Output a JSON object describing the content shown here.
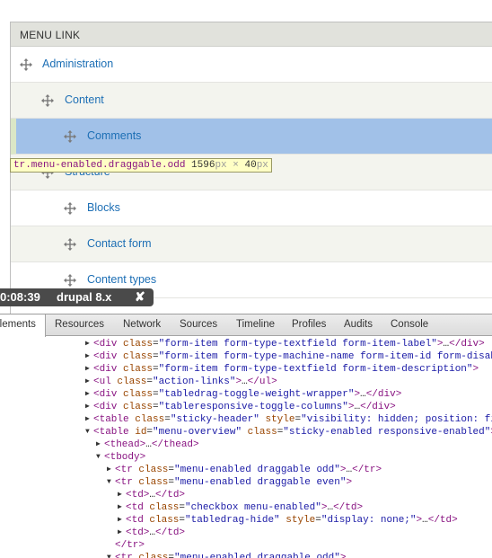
{
  "table": {
    "header": "MENU LINK",
    "rows": [
      {
        "label": "Administration"
      },
      {
        "label": "Content"
      },
      {
        "label": "Comments"
      },
      {
        "label": "Structure"
      },
      {
        "label": "Blocks"
      },
      {
        "label": "Contact form"
      },
      {
        "label": "Content types"
      }
    ]
  },
  "tooltip": {
    "selector": "tr.menu-enabled.draggable.odd",
    "width": "1596",
    "unit": "px",
    "times": "×",
    "height": "40"
  },
  "recording": {
    "time": "0:08:39",
    "site": "drupal 8.x",
    "close": "✘"
  },
  "devtools": {
    "tabs": [
      "Elements",
      "Resources",
      "Network",
      "Sources",
      "Timeline",
      "Profiles",
      "Audits",
      "Console"
    ],
    "active_tab": "Elements",
    "lines": [
      {
        "indent": 0,
        "tri": "▶",
        "parts": [
          [
            "tg",
            "<div "
          ],
          [
            "an",
            "class"
          ],
          [
            "pl",
            "="
          ],
          [
            "av",
            "\"form-item form-type-textfield form-item-label\""
          ],
          [
            "tg",
            ">"
          ],
          [
            "pl",
            "…"
          ],
          [
            "tg",
            "</div>"
          ]
        ]
      },
      {
        "indent": 0,
        "tri": "▶",
        "parts": [
          [
            "tg",
            "<div "
          ],
          [
            "an",
            "class"
          ],
          [
            "pl",
            "="
          ],
          [
            "av",
            "\"form-item form-type-machine-name form-item-id form-disabled\""
          ],
          [
            "tg",
            ">"
          ]
        ]
      },
      {
        "indent": 0,
        "tri": "▶",
        "parts": [
          [
            "tg",
            "<div "
          ],
          [
            "an",
            "class"
          ],
          [
            "pl",
            "="
          ],
          [
            "av",
            "\"form-item form-type-textfield form-item-description\""
          ],
          [
            "tg",
            ">"
          ]
        ]
      },
      {
        "indent": 0,
        "tri": "▶",
        "parts": [
          [
            "tg",
            "<ul "
          ],
          [
            "an",
            "class"
          ],
          [
            "pl",
            "="
          ],
          [
            "av",
            "\"action-links\""
          ],
          [
            "tg",
            ">"
          ],
          [
            "pl",
            "…"
          ],
          [
            "tg",
            "</ul>"
          ]
        ]
      },
      {
        "indent": 0,
        "tri": "▶",
        "parts": [
          [
            "tg",
            "<div "
          ],
          [
            "an",
            "class"
          ],
          [
            "pl",
            "="
          ],
          [
            "av",
            "\"tabledrag-toggle-weight-wrapper\""
          ],
          [
            "tg",
            ">"
          ],
          [
            "pl",
            "…"
          ],
          [
            "tg",
            "</div>"
          ]
        ]
      },
      {
        "indent": 0,
        "tri": "▶",
        "parts": [
          [
            "tg",
            "<div "
          ],
          [
            "an",
            "class"
          ],
          [
            "pl",
            "="
          ],
          [
            "av",
            "\"tableresponsive-toggle-columns\""
          ],
          [
            "tg",
            ">"
          ],
          [
            "pl",
            "…"
          ],
          [
            "tg",
            "</div>"
          ]
        ]
      },
      {
        "indent": 0,
        "tri": "▶",
        "parts": [
          [
            "tg",
            "<table "
          ],
          [
            "an",
            "class"
          ],
          [
            "pl",
            "="
          ],
          [
            "av",
            "\"sticky-header\""
          ],
          [
            "pl",
            " "
          ],
          [
            "an",
            "style"
          ],
          [
            "pl",
            "="
          ],
          [
            "av",
            "\"visibility: hidden; position: fixed;\""
          ],
          [
            "tg",
            ">"
          ]
        ]
      },
      {
        "indent": 0,
        "tri": "▼",
        "parts": [
          [
            "tg",
            "<table "
          ],
          [
            "an",
            "id"
          ],
          [
            "pl",
            "="
          ],
          [
            "av",
            "\"menu-overview\""
          ],
          [
            "pl",
            " "
          ],
          [
            "an",
            "class"
          ],
          [
            "pl",
            "="
          ],
          [
            "av",
            "\"sticky-enabled responsive-enabled\""
          ],
          [
            "tg",
            ">"
          ]
        ]
      },
      {
        "indent": 1,
        "tri": "▶",
        "parts": [
          [
            "tg",
            "<thead>"
          ],
          [
            "pl",
            "…"
          ],
          [
            "tg",
            "</thead>"
          ]
        ]
      },
      {
        "indent": 1,
        "tri": "▼",
        "parts": [
          [
            "tg",
            "<tbody>"
          ]
        ]
      },
      {
        "indent": 2,
        "tri": "▶",
        "parts": [
          [
            "tg",
            "<tr "
          ],
          [
            "an",
            "class"
          ],
          [
            "pl",
            "="
          ],
          [
            "av",
            "\"menu-enabled draggable odd\""
          ],
          [
            "tg",
            ">"
          ],
          [
            "pl",
            "…"
          ],
          [
            "tg",
            "</tr>"
          ]
        ]
      },
      {
        "indent": 2,
        "tri": "▼",
        "parts": [
          [
            "tg",
            "<tr "
          ],
          [
            "an",
            "class"
          ],
          [
            "pl",
            "="
          ],
          [
            "av",
            "\"menu-enabled draggable even\""
          ],
          [
            "tg",
            ">"
          ]
        ]
      },
      {
        "indent": 3,
        "tri": "▶",
        "parts": [
          [
            "tg",
            "<td>"
          ],
          [
            "pl",
            "…"
          ],
          [
            "tg",
            "</td>"
          ]
        ]
      },
      {
        "indent": 3,
        "tri": "▶",
        "parts": [
          [
            "tg",
            "<td "
          ],
          [
            "an",
            "class"
          ],
          [
            "pl",
            "="
          ],
          [
            "av",
            "\"checkbox menu-enabled\""
          ],
          [
            "tg",
            ">"
          ],
          [
            "pl",
            "…"
          ],
          [
            "tg",
            "</td>"
          ]
        ]
      },
      {
        "indent": 3,
        "tri": "▶",
        "parts": [
          [
            "tg",
            "<td "
          ],
          [
            "an",
            "class"
          ],
          [
            "pl",
            "="
          ],
          [
            "av",
            "\"tabledrag-hide\""
          ],
          [
            "pl",
            " "
          ],
          [
            "an",
            "style"
          ],
          [
            "pl",
            "="
          ],
          [
            "av",
            "\"display: none;\""
          ],
          [
            "tg",
            ">"
          ],
          [
            "pl",
            "…"
          ],
          [
            "tg",
            "</td>"
          ]
        ]
      },
      {
        "indent": 3,
        "tri": "▶",
        "parts": [
          [
            "tg",
            "<td>"
          ],
          [
            "pl",
            "…"
          ],
          [
            "tg",
            "</td>"
          ]
        ]
      },
      {
        "indent": 2,
        "tri": "",
        "parts": [
          [
            "tg",
            "</tr>"
          ]
        ]
      },
      {
        "indent": 2,
        "tri": "▼",
        "parts": [
          [
            "tg",
            "<tr "
          ],
          [
            "an",
            "class"
          ],
          [
            "pl",
            "="
          ],
          [
            "av",
            "\"menu-enabled draggable odd\""
          ],
          [
            "tg",
            ">"
          ]
        ]
      }
    ]
  }
}
